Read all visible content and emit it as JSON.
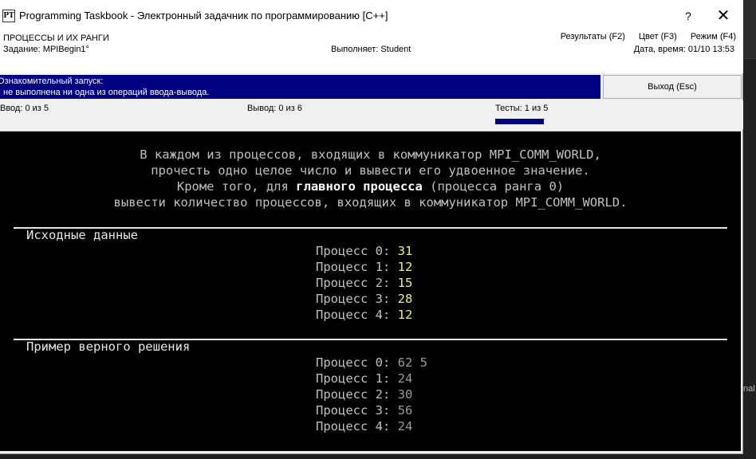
{
  "window": {
    "title": "Programming Taskbook - Электронный задачник по программированию [C++]",
    "icon_text": "PT",
    "help_label": "?",
    "close_label": "✕"
  },
  "info": {
    "section": "ПРОЦЕССЫ И ИХ РАНГИ",
    "task": "Задание: MPIBegin1°",
    "performer": "Выполняет: Student",
    "datetime": "Дата, время: 01/10 13:53",
    "menu": {
      "results": "Результаты (F2)",
      "color": "Цвет (F3)",
      "mode": "Режим (F4)"
    }
  },
  "status": {
    "line1": "Ознакомительный запуск:",
    "line2": "не выполнена ни одна из операций ввода-вывода.",
    "exit_label": "Выход (Esc)"
  },
  "counters": {
    "input": "Ввод:  0 из 5",
    "output": "Вывод:  0 из 6",
    "tests": "Тесты:  1 из 5",
    "tests_progress": 0.2
  },
  "description": {
    "line1": "В каждом из процессов, входящих в коммуникатор MPI_COMM_WORLD,",
    "line2": "прочесть одно целое число и вывести его удвоенное значение.",
    "line3_pre": "Кроме того, для ",
    "line3_bold": "главного процесса",
    "line3_post": " (процесса ранга 0)",
    "line4": "вывести количество процессов, входящих в коммуникатор MPI_COMM_WORLD."
  },
  "input_data": {
    "title": "Исходные данные",
    "rows": [
      {
        "label": "Процесс 0: ",
        "value": "31"
      },
      {
        "label": "Процесс 1: ",
        "value": "12"
      },
      {
        "label": "Процесс 2: ",
        "value": "15"
      },
      {
        "label": "Процесс 3: ",
        "value": "28"
      },
      {
        "label": "Процесс 4: ",
        "value": "12"
      }
    ]
  },
  "solution": {
    "title": "Пример верного решения",
    "rows": [
      {
        "label": "Процесс 0: ",
        "value": "62 5"
      },
      {
        "label": "Процесс 1: ",
        "value": "24"
      },
      {
        "label": "Процесс 2: ",
        "value": "30"
      },
      {
        "label": "Процесс 3: ",
        "value": "56"
      },
      {
        "label": "Процесс 4: ",
        "value": "24"
      }
    ]
  },
  "background": {
    "side_text": "nal"
  }
}
